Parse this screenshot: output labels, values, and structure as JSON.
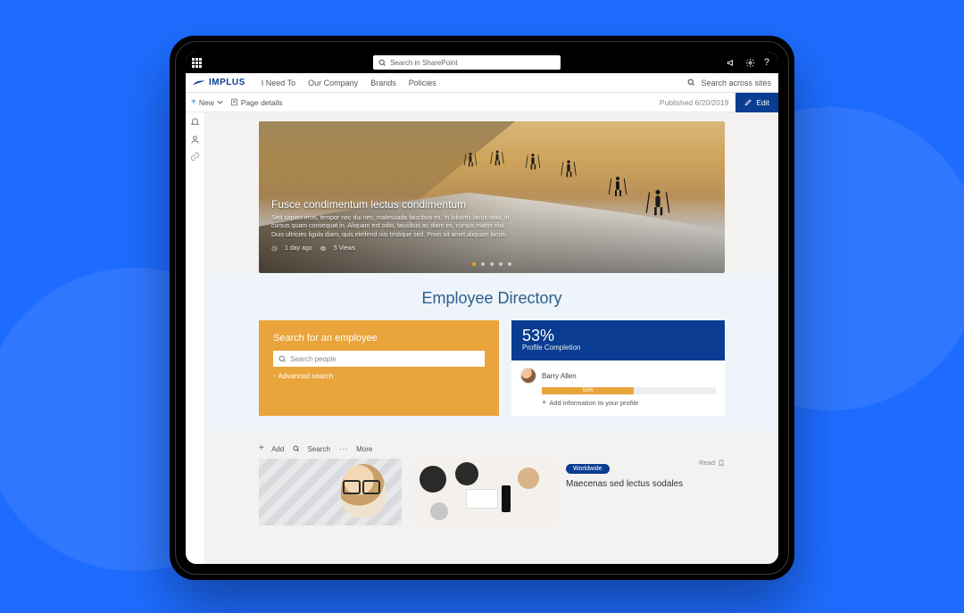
{
  "o365": {
    "search_placeholder": "Search in SharePoint",
    "icons": [
      "megaphone-icon",
      "gear-icon",
      "help-icon"
    ]
  },
  "brand": {
    "name": "IMPLUS"
  },
  "nav": {
    "links": [
      "I Need To",
      "Our Company",
      "Brands",
      "Policies"
    ],
    "search_label": "Search across sites"
  },
  "cmd": {
    "new": "New",
    "page_details": "Page details",
    "published": "Published 6/20/2019",
    "edit": "Edit"
  },
  "hero": {
    "title": "Fusce condimentum lectus condimentum",
    "desc": "Sed sapien eros, tempor nec dui nec, malesuada faucibus ex. In lobortis lacus odio, in cursus quam consequat in. Aliquam est odio, faucibus ac diam ex, cursus mattis nisi. Duis ultricies ligula diam, quis eleifend nisi tristique sed. Proin sit amet aliquam lacus.",
    "meta_time": "1 day ago",
    "meta_views": "5 Views",
    "dot_count": 5,
    "active_dot": 0
  },
  "directory": {
    "section_title": "Employee Directory",
    "search_heading": "Search for an employee",
    "search_placeholder": "Search people",
    "advanced": "Advanced search",
    "profile": {
      "percent": "53%",
      "label": "Profile Completion",
      "person": "Barry Allen",
      "bar_label": "53%",
      "add_info": "Add information to your profile"
    }
  },
  "news": {
    "cmd": {
      "add": "Add",
      "search": "Search",
      "more": "More"
    },
    "badge": "Worldwide",
    "read": "Read",
    "item_title": "Maecenas sed lectus sodales"
  }
}
